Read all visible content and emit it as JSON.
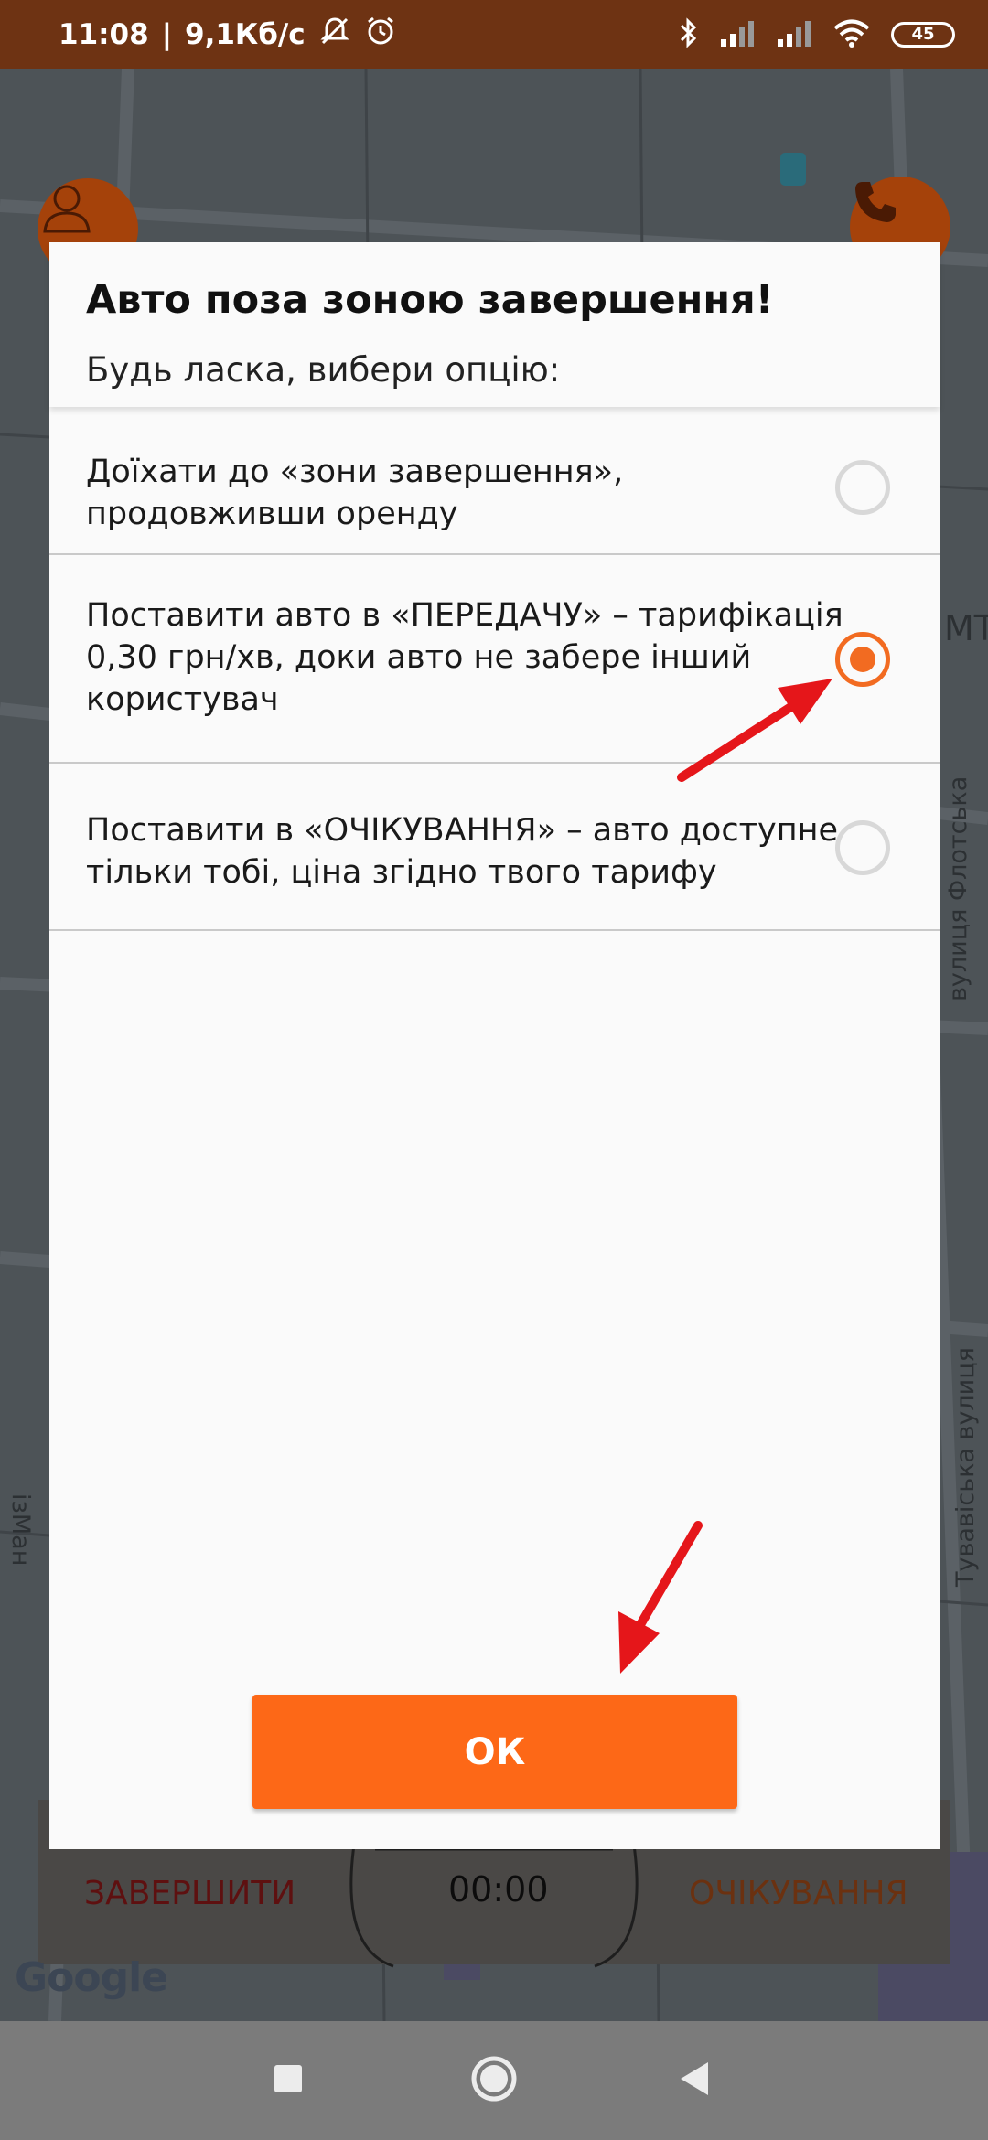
{
  "status_bar": {
    "time": "11:08",
    "speed": "9,1Кб/с",
    "battery": "45"
  },
  "map": {
    "street_right_label": "МТ",
    "street_1": "вулиця Флотська",
    "street_2": "Тувавіська вулиця",
    "street_left": "ізМан",
    "google_logo": "Google"
  },
  "bottom_panel": {
    "finish_label": "ЗАВЕРШИТИ",
    "timer": "00:00",
    "wait_label": "ОЧІКУВАННЯ"
  },
  "dialog": {
    "title": "Авто поза зоною завершення!",
    "subtitle": "Будь ласка, вибери опцію:",
    "options": [
      {
        "label": "Доїхати до «зони завершення», продовживши оренду",
        "selected": false
      },
      {
        "label": "Поставити авто в «ПЕРЕДАЧУ» – тарифікація 0,30 грн/хв, доки авто не забере інший користувач",
        "selected": true
      },
      {
        "label": "Поставити в «ОЧІКУВАННЯ» – авто доступне тільки тобі, ціна згідно твого тарифу",
        "selected": false
      }
    ],
    "ok_label": "ОК"
  },
  "colors": {
    "accent": "#fd6817",
    "status_bar": "#6e3313",
    "map_button": "#a5420a",
    "annotation_arrow": "#e5161a"
  },
  "icons": {
    "profile": "person-icon",
    "call": "phone-icon",
    "nav_recents": "square-icon",
    "nav_home": "circle-icon",
    "nav_back": "triangle-back-icon"
  }
}
